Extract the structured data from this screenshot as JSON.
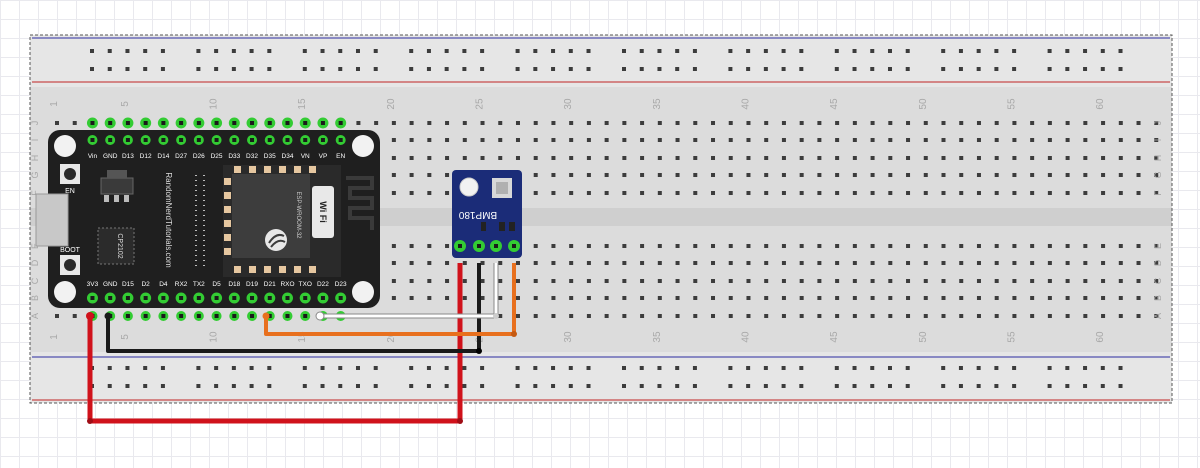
{
  "breadboard": {
    "column_numbers": [
      "1",
      "5",
      "10",
      "15",
      "20",
      "25",
      "30",
      "35",
      "40",
      "45",
      "50",
      "55",
      "60"
    ],
    "row_letters_top": [
      "J",
      "I",
      "H",
      "G",
      "F"
    ],
    "row_letters_bottom": [
      "E",
      "D",
      "C",
      "B",
      "A"
    ]
  },
  "esp32": {
    "top_pins": [
      "Vin",
      "GND",
      "D13",
      "D12",
      "D14",
      "D27",
      "D26",
      "D25",
      "D33",
      "D32",
      "D35",
      "D34",
      "VN",
      "VP",
      "EN"
    ],
    "bottom_pins": [
      "3V3",
      "GND",
      "D15",
      "D2",
      "D4",
      "RX2",
      "TX2",
      "D5",
      "D18",
      "D19",
      "D21",
      "RXO",
      "TXO",
      "D22",
      "D23"
    ],
    "button_en": "EN",
    "button_boot": "BOOT",
    "chip_label": "CP2102",
    "brand": "RandomNerdTutorials.com",
    "module": "ESP-WROOM-32",
    "wifi": "Wi Fi"
  },
  "sensor": {
    "name": "BMP180"
  },
  "colors": {
    "board": "#1f1f1f",
    "sensor": "#1b2c78",
    "wire_power": "#d0121b",
    "wire_ground": "#1a1a1a",
    "wire_sda": "#ffffff",
    "wire_scl": "#e8701e",
    "rail_red": "#c02424",
    "rail_blue": "#2c2ca0",
    "pin_green": "#33cc33"
  }
}
